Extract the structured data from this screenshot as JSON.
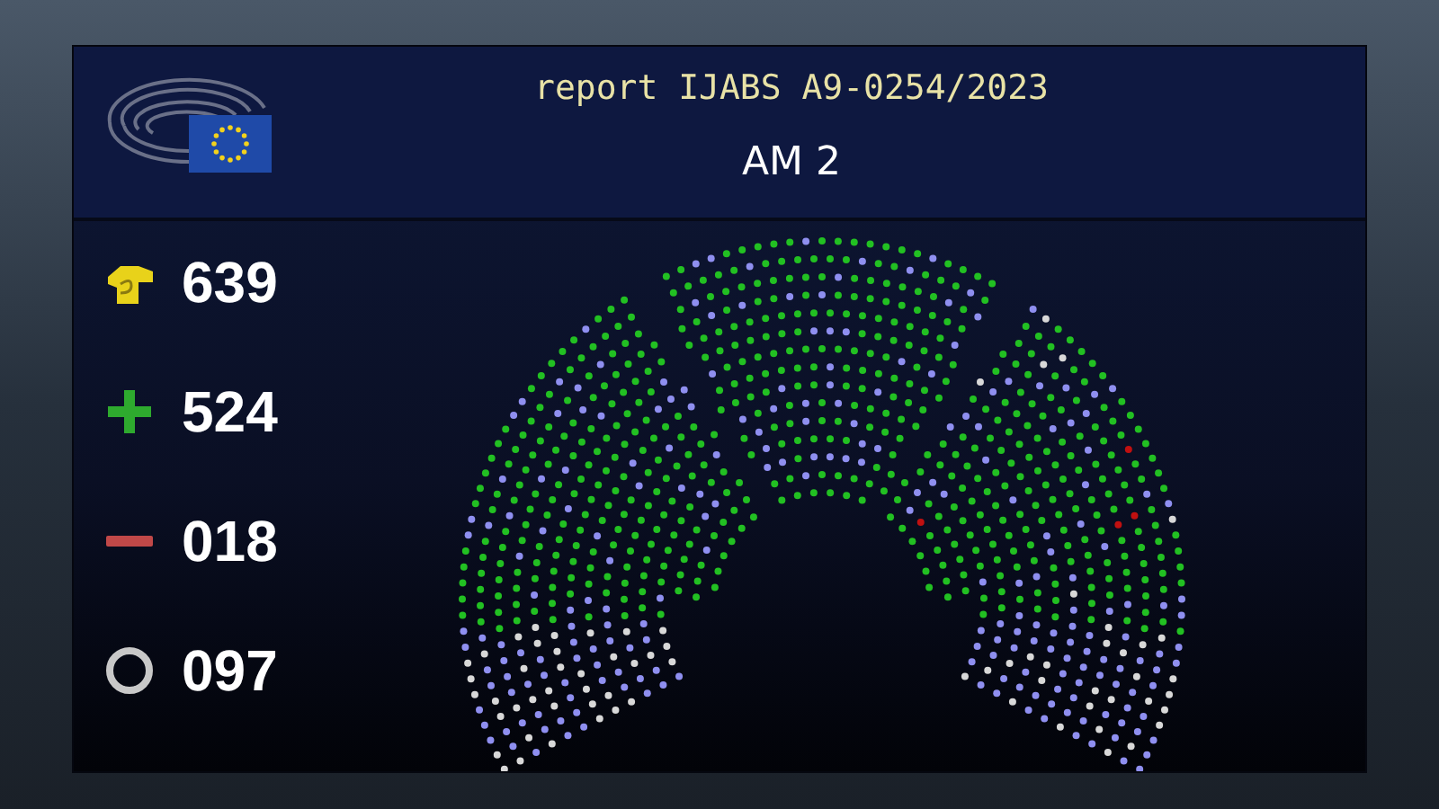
{
  "screen": {
    "title": "report IJABS A9-0254/2023",
    "subtitle": "AM 2"
  },
  "tallies": [
    {
      "kind": "voters",
      "count": "639"
    },
    {
      "kind": "for",
      "count": "524"
    },
    {
      "kind": "against",
      "count": "018"
    },
    {
      "kind": "abstain",
      "count": "097"
    }
  ]
}
